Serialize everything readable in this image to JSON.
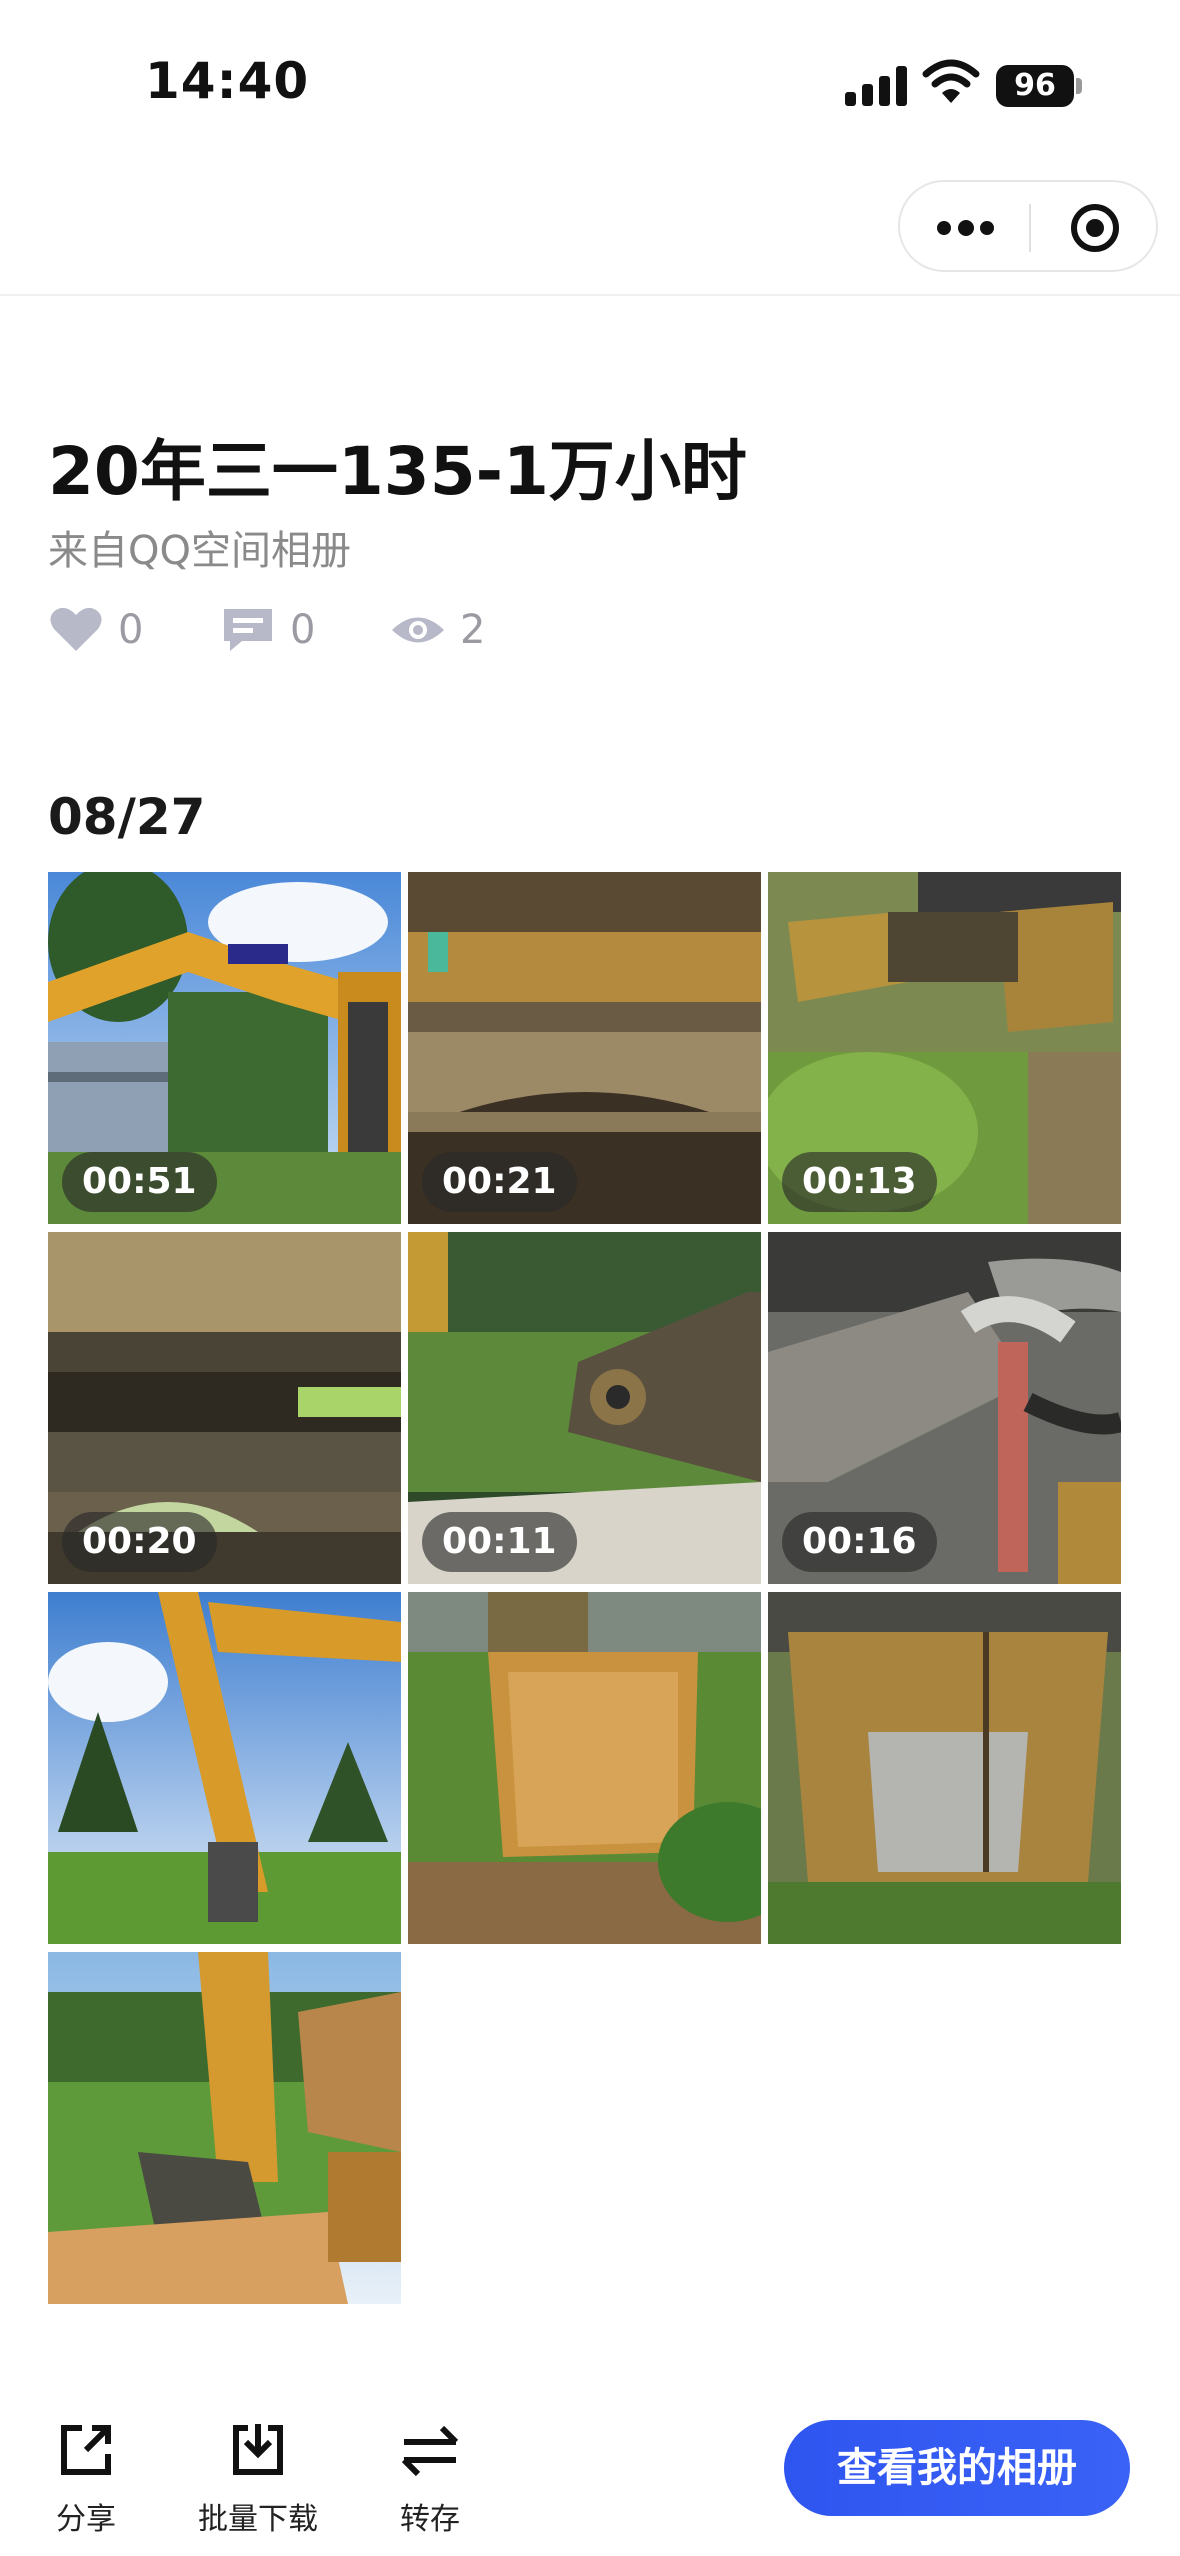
{
  "status_bar": {
    "time": "14:40",
    "battery": "96",
    "icons": [
      "signal-icon",
      "wifi-icon",
      "battery-icon"
    ]
  },
  "capsule": {
    "icons": [
      "more-icon",
      "close-icon"
    ]
  },
  "album": {
    "title": "20年三一135-1万小时",
    "source": "来自QQ空间相册",
    "likes": "0",
    "comments": "0",
    "views": "2"
  },
  "date_group": {
    "label": "08/27",
    "items": [
      {
        "type": "video",
        "duration": "00:51",
        "scene": "sany-excavator-arm-sky"
      },
      {
        "type": "video",
        "duration": "00:21",
        "scene": "rusty-track-closeup"
      },
      {
        "type": "video",
        "duration": "00:13",
        "scene": "excavator-tracks-on-grass"
      },
      {
        "type": "video",
        "duration": "00:20",
        "scene": "undercarriage-closeup"
      },
      {
        "type": "video",
        "duration": "00:11",
        "scene": "excavator-on-road"
      },
      {
        "type": "video",
        "duration": "00:16",
        "scene": "engine-bay"
      },
      {
        "type": "photo",
        "scene": "boom-arm-with-trees"
      },
      {
        "type": "photo",
        "scene": "bucket-front"
      },
      {
        "type": "photo",
        "scene": "bucket-teeth-closeup"
      },
      {
        "type": "photo",
        "scene": "arm-and-bucket-side"
      }
    ]
  },
  "bottom_bar": {
    "share_label": "分享",
    "download_label": "批量下载",
    "transfer_label": "转存",
    "view_album_label": "查看我的相册"
  },
  "colors": {
    "accent": "#2f54eb",
    "stat_icon": "#b7b8c8",
    "secondary_text": "#8a8a8a"
  }
}
